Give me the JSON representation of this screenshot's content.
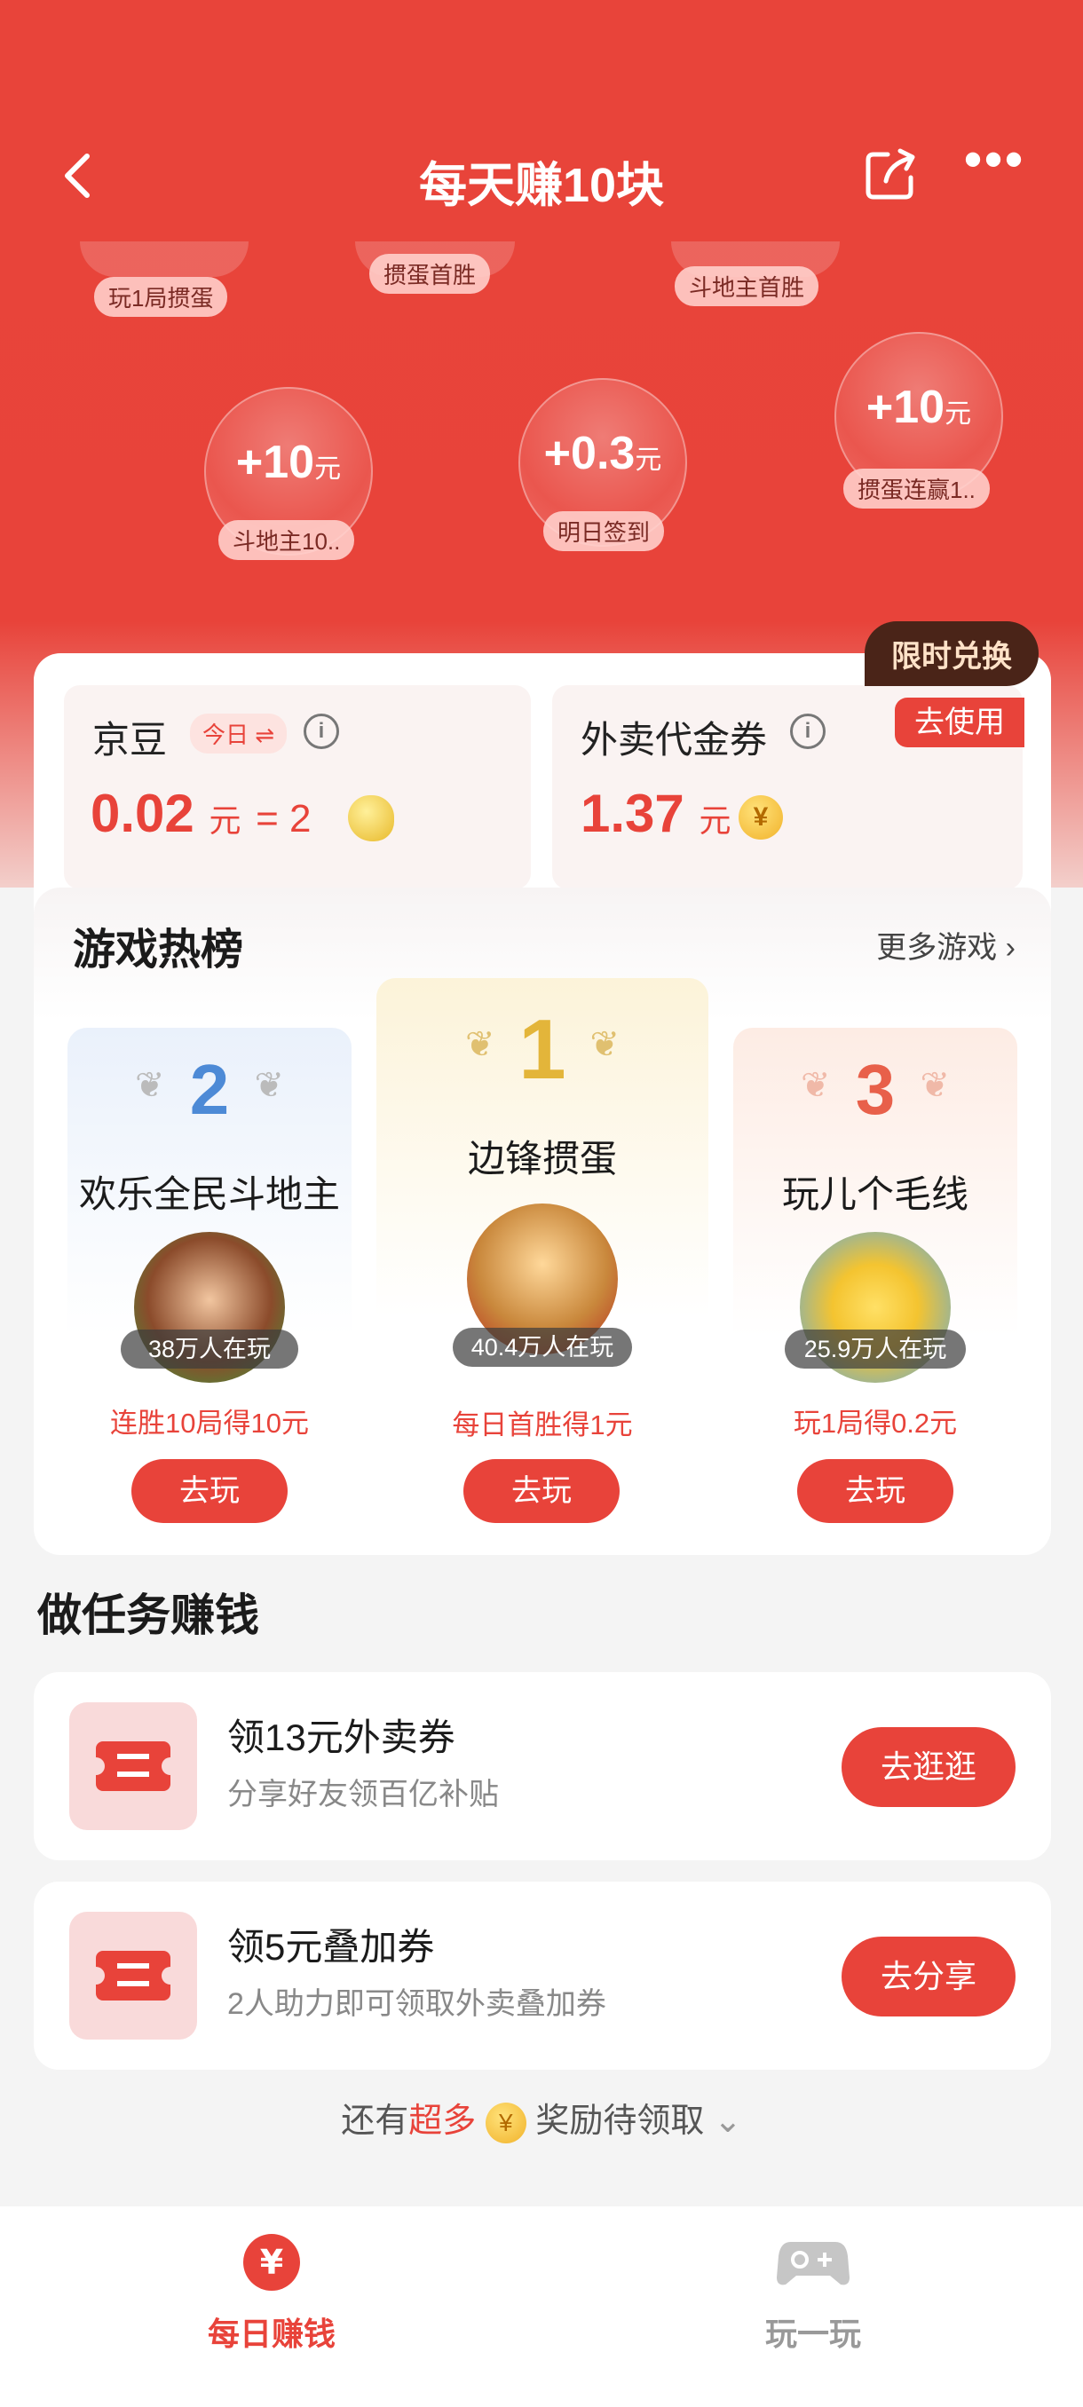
{
  "header": {
    "title": "每天赚10块"
  },
  "bubbles": {
    "top": [
      "玩1局掼蛋",
      "掼蛋首胜",
      "斗地主首胜"
    ],
    "items": [
      {
        "value": "+10",
        "unit": "元",
        "label": "斗地主10.."
      },
      {
        "value": "+0.3",
        "unit": "元",
        "label": "明日签到"
      },
      {
        "value": "+10",
        "unit": "元",
        "label": "掼蛋连赢1.."
      }
    ]
  },
  "limited": {
    "badge": "限时兑换",
    "use": "去使用"
  },
  "beans": {
    "label": "京豆",
    "today": "今日 ⇌",
    "info": "i",
    "amount": "0.02",
    "unit": "元",
    "eq": "= 2"
  },
  "voucher": {
    "label": "外卖代金券",
    "info": "i",
    "amount": "1.37",
    "unit": "元",
    "coin": "¥"
  },
  "ranking": {
    "title": "游戏热榜",
    "more": "更多游戏 ›",
    "games": [
      {
        "rank": "2",
        "name": "欢乐全民斗地主",
        "players": "38万人在玩",
        "reward": "连胜10局得10元",
        "button": "去玩"
      },
      {
        "rank": "1",
        "name": "边锋掼蛋",
        "players": "40.4万人在玩",
        "reward": "每日首胜得1元",
        "button": "去玩"
      },
      {
        "rank": "3",
        "name": "玩儿个毛线",
        "players": "25.9万人在玩",
        "reward": "玩1局得0.2元",
        "button": "去玩"
      }
    ]
  },
  "tasks": {
    "title": "做任务赚钱",
    "items": [
      {
        "title": "领13元外卖券",
        "subtitle": "分享好友领百亿补贴",
        "button": "去逛逛"
      },
      {
        "title": "领5元叠加券",
        "subtitle": "2人助力即可领取外卖叠加券",
        "button": "去分享"
      }
    ]
  },
  "more_rewards": {
    "prefix": "还有",
    "highlight": "超多",
    "coin": "¥",
    "suffix": "奖励待领取",
    "chevron": "⌄"
  },
  "tabbar": {
    "items": [
      {
        "label": "每日赚钱",
        "icon": "yen-coin-icon",
        "active": true
      },
      {
        "label": "玩一玩",
        "icon": "gamepad-icon",
        "active": false
      }
    ]
  },
  "colors": {
    "primary": "#e8433a",
    "header_bg": "#e8443a",
    "muted": "#888888"
  }
}
